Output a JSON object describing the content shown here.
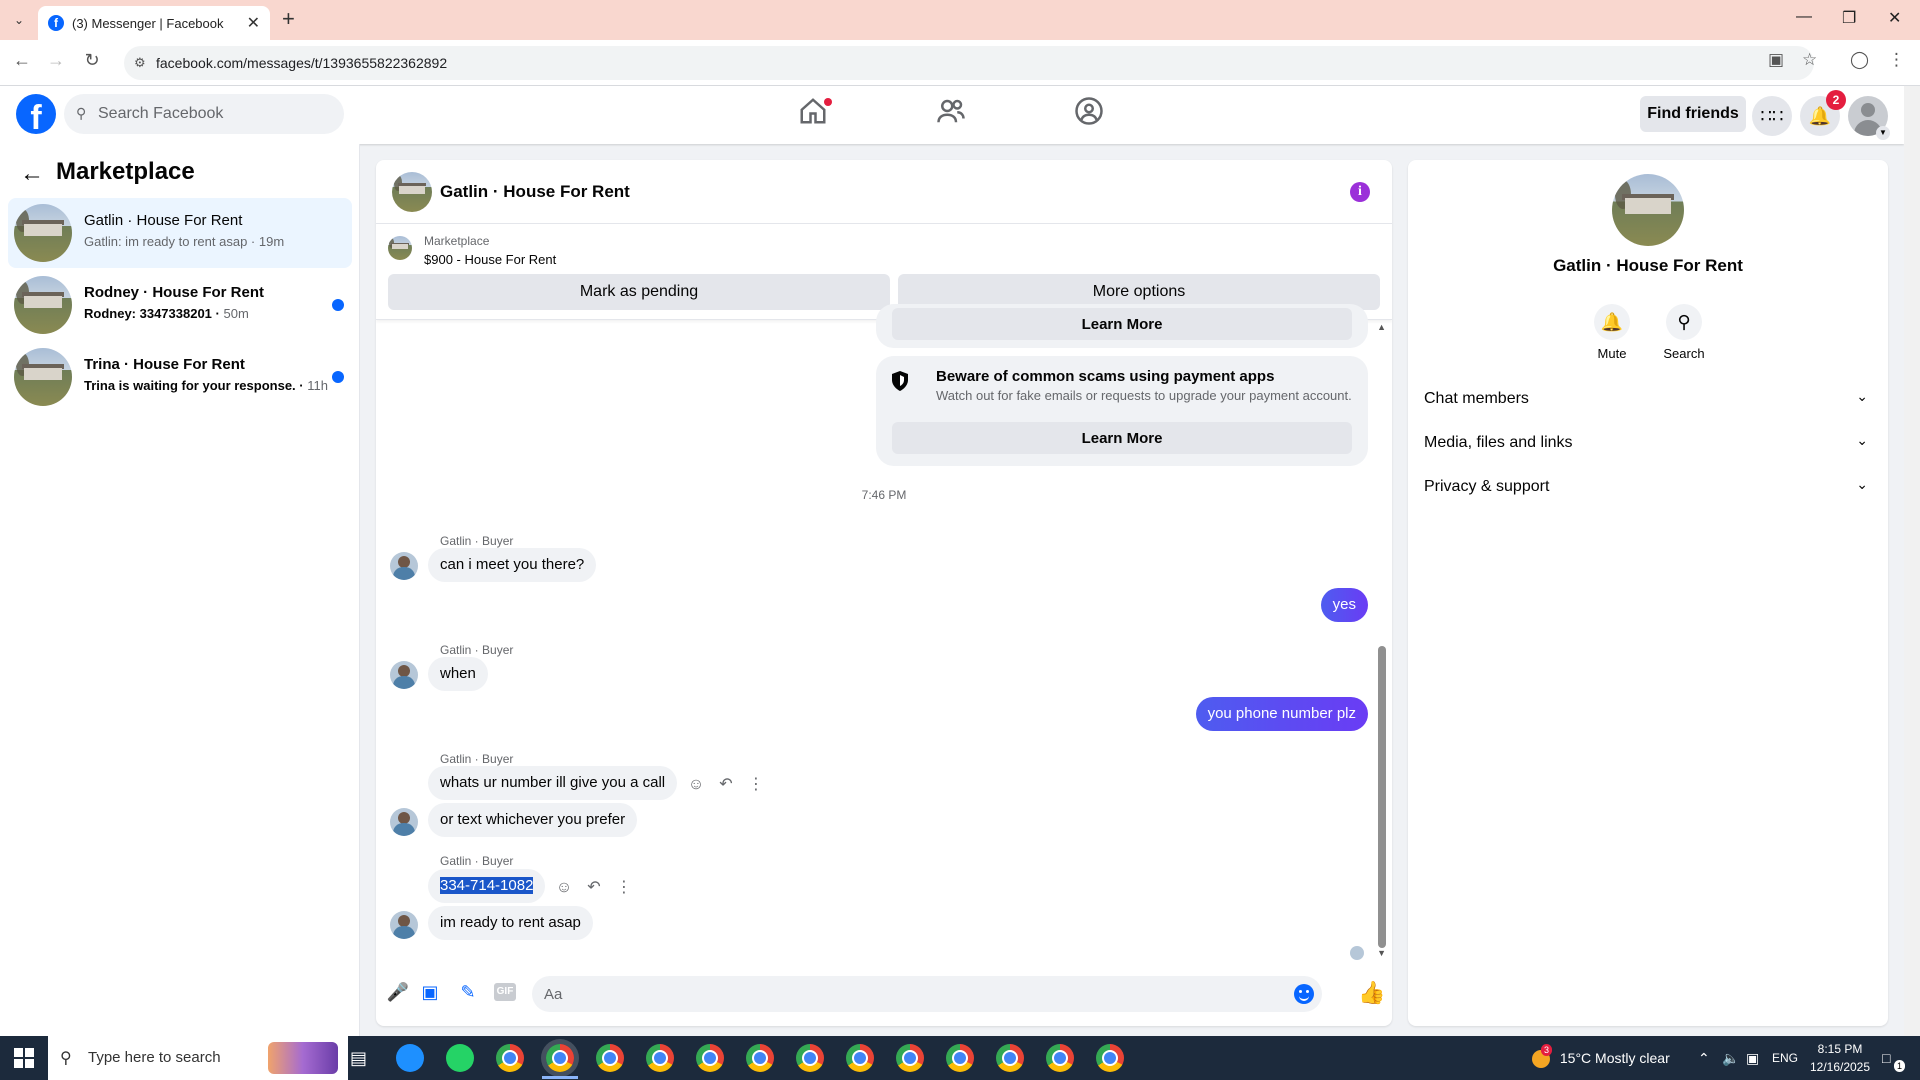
{
  "browser": {
    "tab_title": "(3) Messenger | Facebook",
    "url": "facebook.com/messages/t/1393655822362892"
  },
  "header": {
    "search_placeholder": "Search Facebook",
    "find_friends_label": "Find friends",
    "notification_count": "2"
  },
  "left_panel": {
    "title": "Marketplace",
    "conversations": [
      {
        "name": "Gatlin · House For Rent",
        "preview": "Gatlin: im ready to rent asap",
        "time": "19m",
        "unread": false,
        "active": true
      },
      {
        "name": "Rodney · House For Rent",
        "preview": "Rodney: 3347338201",
        "time": "50m",
        "unread": true,
        "active": false
      },
      {
        "name": "Trina · House For Rent",
        "preview": "Trina is waiting for your response.",
        "time": "11h",
        "unread": true,
        "active": false
      }
    ]
  },
  "chat": {
    "title": "Gatlin · House For Rent",
    "listing_label": "Marketplace",
    "listing_price": "$900 - House For Rent",
    "mark_pending_label": "Mark as pending",
    "more_options_label": "More options",
    "learn_more_label": "Learn More",
    "scam_notice": {
      "title": "Beware of common scams using payment apps",
      "subtitle": "Watch out for fake emails or requests to upgrade your payment account."
    },
    "timestamp": "7:46 PM",
    "sender_label": "Gatlin · Buyer",
    "messages": {
      "m1": "can i meet you there?",
      "m2": "yes",
      "m3": "when",
      "m4": "you phone number plz",
      "m5": "whats ur number ill give you a call",
      "m6": "or text whichever you prefer",
      "m7": "334-714-1082",
      "m8": "im ready to rent asap"
    },
    "composer_placeholder": "Aa"
  },
  "right_panel": {
    "name": "Gatlin · House For Rent",
    "mute_label": "Mute",
    "search_label": "Search",
    "sections": [
      "Chat members",
      "Media, files and links",
      "Privacy & support"
    ]
  },
  "taskbar": {
    "search_placeholder": "Type here to search",
    "weather": "15°C  Mostly clear",
    "weather_badge": "3",
    "language": "ENG",
    "time": "8:15 PM",
    "date": "12/16/2025",
    "notification_count": "1"
  },
  "colors": {
    "facebook_blue": "#0866ff",
    "outgoing_bubble": "#5b4df2",
    "badge_red": "#e41e3f"
  }
}
